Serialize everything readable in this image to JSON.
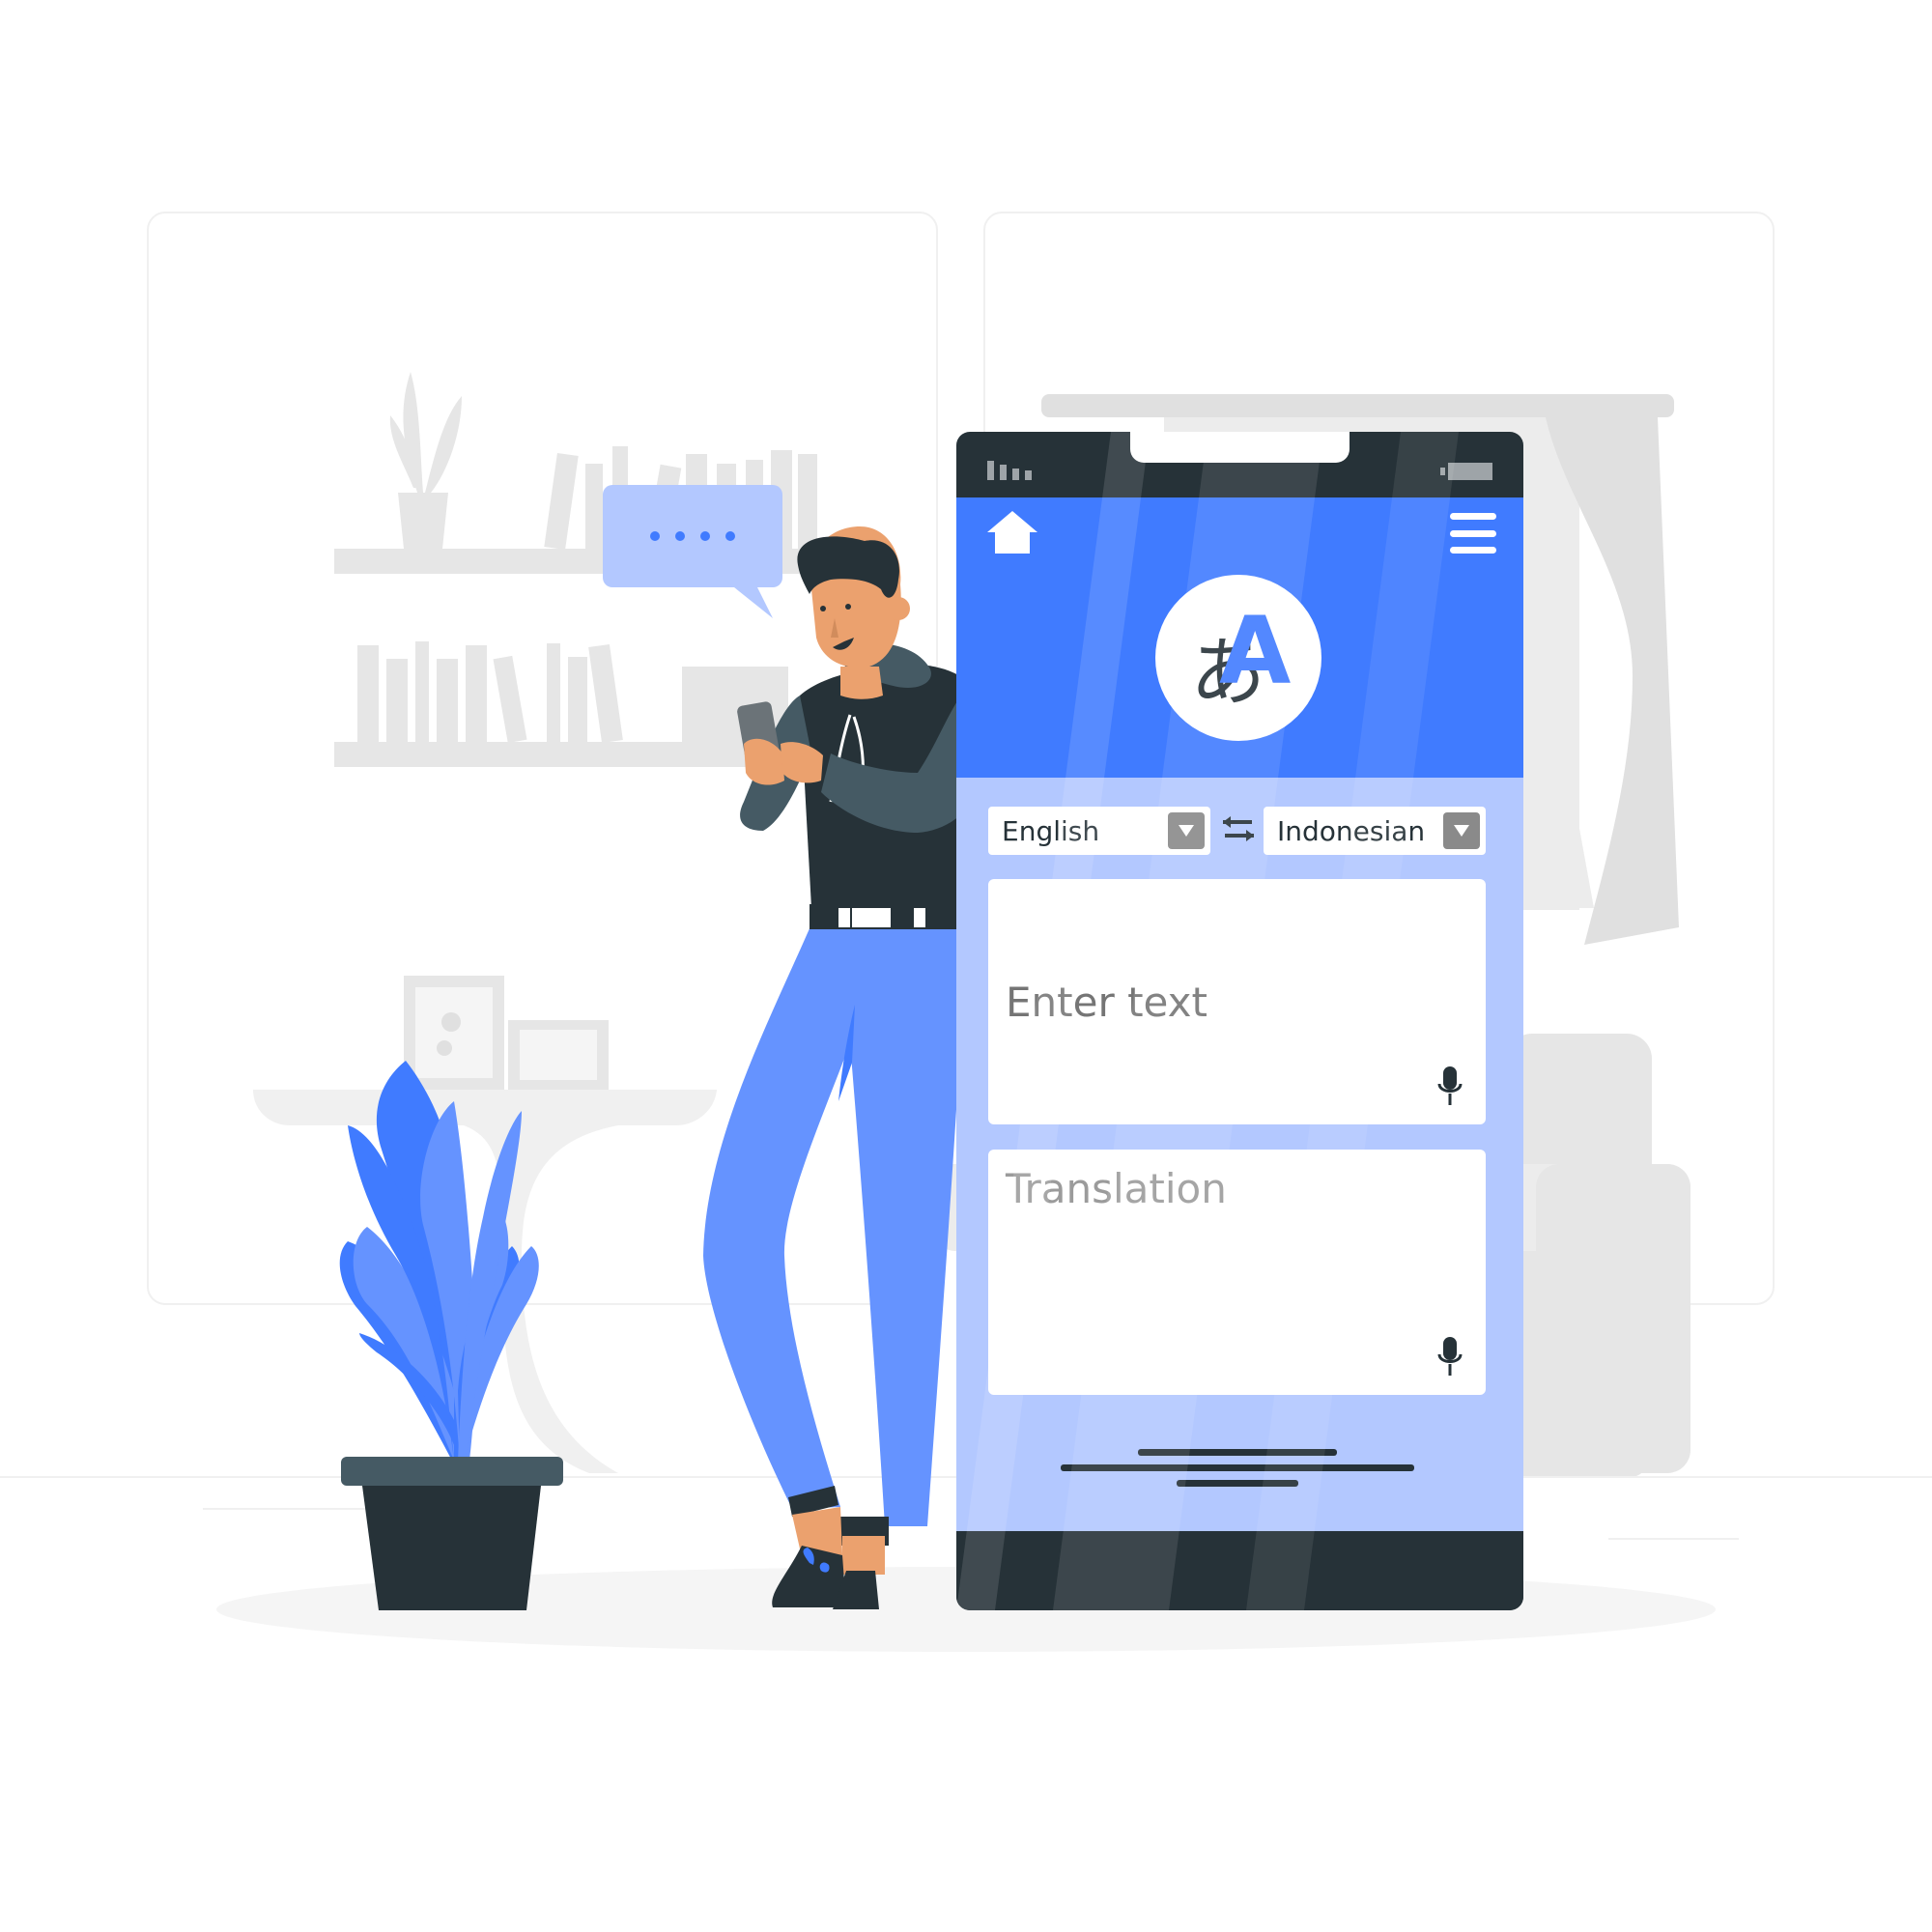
{
  "app": {
    "source_language": "English",
    "target_language": "Indonesian",
    "input": {
      "placeholder": "Enter text"
    },
    "output": {
      "placeholder": "Translation"
    }
  },
  "icons": {
    "home": "home-icon",
    "menu": "hamburger-menu-icon",
    "logo": "translate-icon",
    "dropdown": "chevron-down-icon",
    "swap": "swap-arrows-icon",
    "mic": "microphone-icon",
    "chat": "speech-bubble-icon"
  },
  "colors": {
    "accent": "#407bff",
    "accent_light": "#b3c8ff",
    "dark": "#263238",
    "background_grey": "#e6e6e6"
  }
}
